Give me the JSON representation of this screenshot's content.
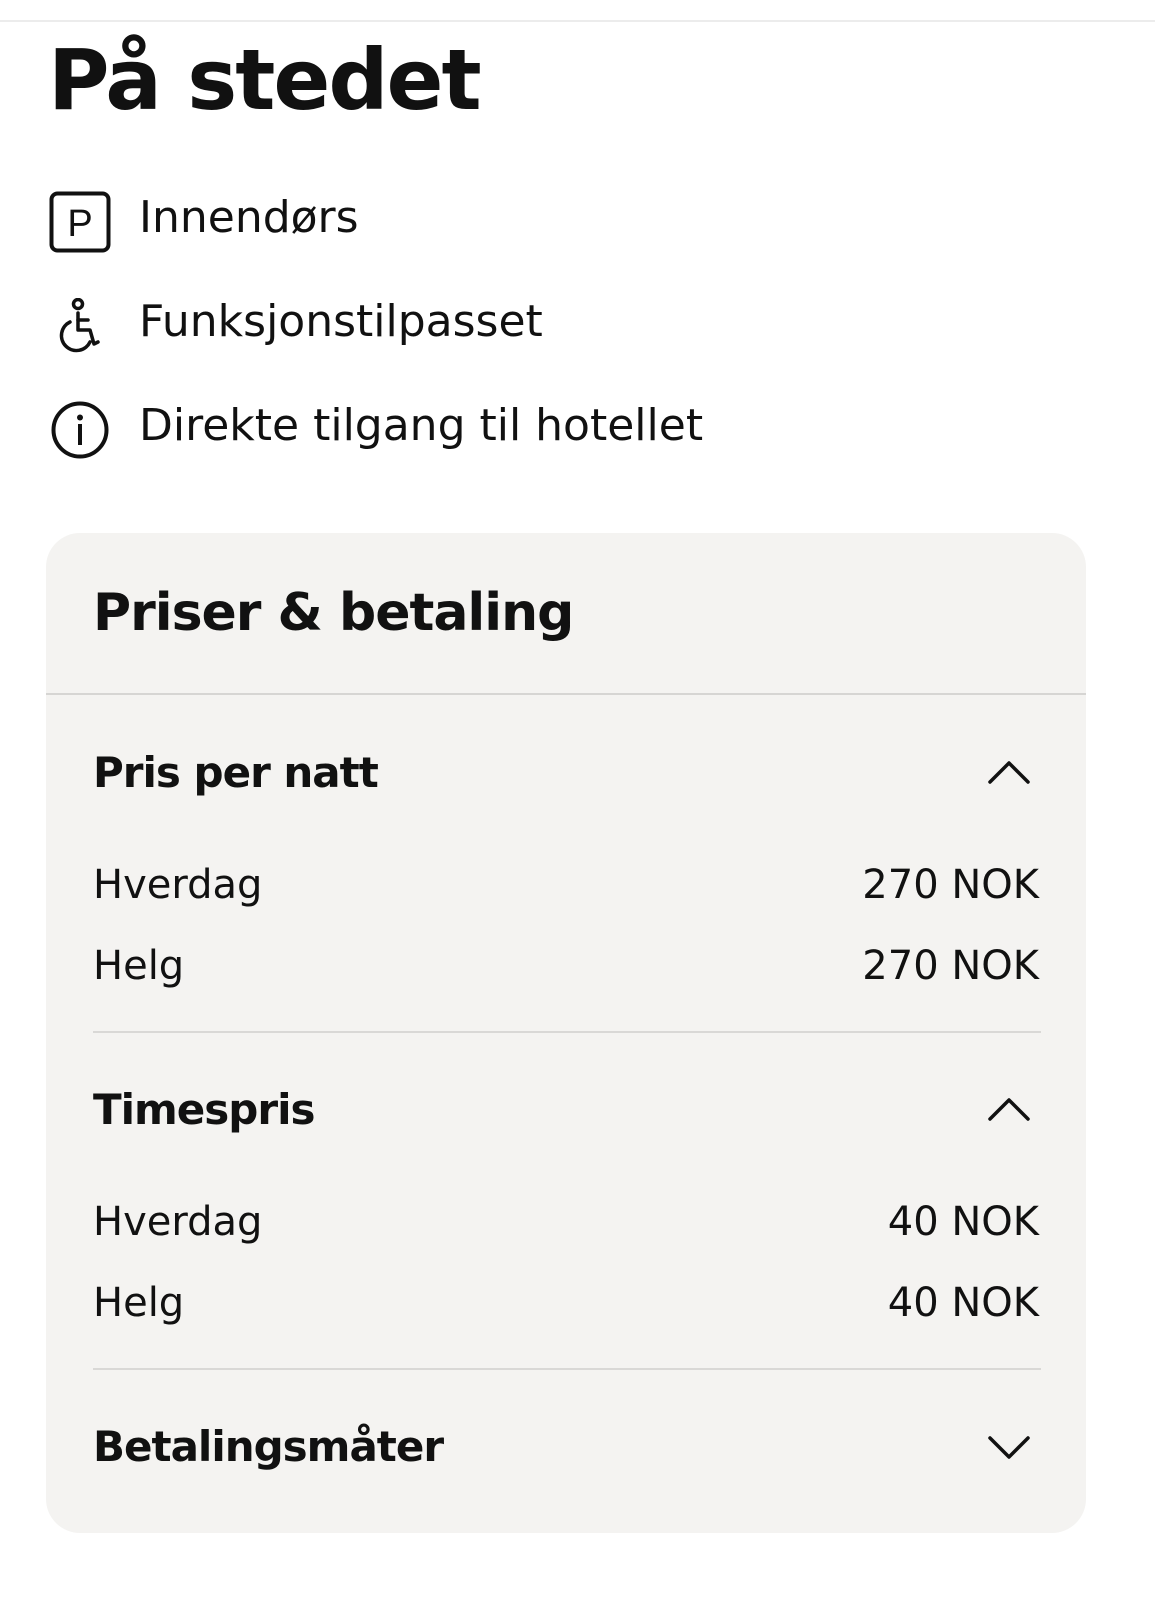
{
  "page": {
    "title": "På stedet"
  },
  "features": [
    {
      "icon": "parking-icon",
      "label": "Innendørs"
    },
    {
      "icon": "wheelchair-icon",
      "label": "Funksjonstilpasset"
    },
    {
      "icon": "info-icon",
      "label": "Direkte tilgang til hotellet"
    }
  ],
  "pricing": {
    "title": "Priser & betaling",
    "sections": [
      {
        "title": "Pris per natt",
        "expanded": true,
        "chevron": "chevron-up-icon",
        "rows": [
          {
            "label": "Hverdag",
            "value": "270 NOK"
          },
          {
            "label": "Helg",
            "value": "270 NOK"
          }
        ]
      },
      {
        "title": "Timespris",
        "expanded": true,
        "chevron": "chevron-up-icon",
        "rows": [
          {
            "label": "Hverdag",
            "value": "40 NOK"
          },
          {
            "label": "Helg",
            "value": "40 NOK"
          }
        ]
      },
      {
        "title": "Betalingsmåter",
        "expanded": false,
        "chevron": "chevron-down-icon",
        "rows": []
      }
    ]
  }
}
